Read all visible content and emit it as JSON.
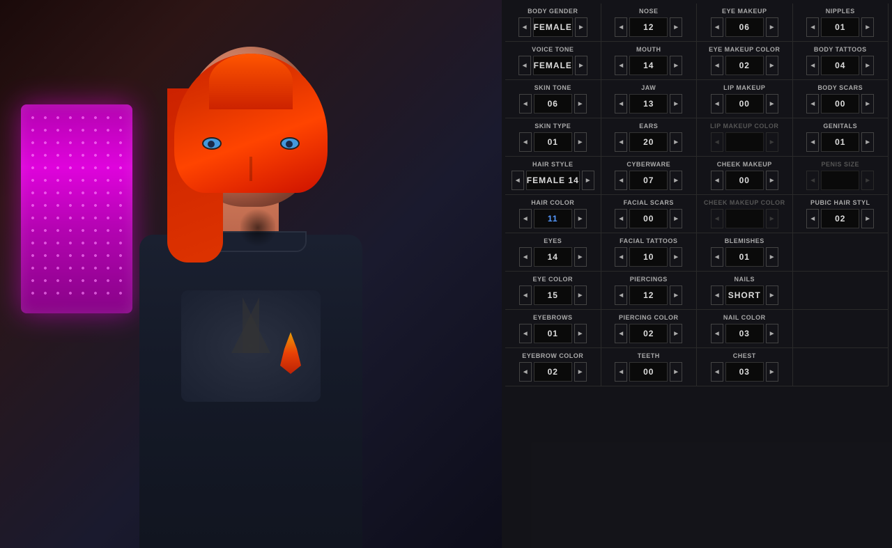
{
  "character_panel": {
    "rows": [
      {
        "cells": [
          {
            "label": "BODY GENDER",
            "value": "FEMALE",
            "value_class": "",
            "left_disabled": false,
            "right_disabled": false,
            "col": 1
          },
          {
            "label": "NOSE",
            "value": "12",
            "value_class": "",
            "left_disabled": false,
            "right_disabled": false,
            "col": 2
          },
          {
            "label": "EYE MAKEUP",
            "value": "06",
            "value_class": "",
            "left_disabled": false,
            "right_disabled": false,
            "col": 3
          },
          {
            "label": "NIPPLES",
            "value": "01",
            "value_class": "",
            "left_disabled": false,
            "right_disabled": false,
            "col": 4
          }
        ]
      },
      {
        "cells": [
          {
            "label": "VOICE TONE",
            "value": "FEMALE",
            "value_class": "",
            "left_disabled": false,
            "right_disabled": false,
            "col": 1
          },
          {
            "label": "MOUTH",
            "value": "14",
            "value_class": "",
            "left_disabled": false,
            "right_disabled": false,
            "col": 2
          },
          {
            "label": "EYE MAKEUP COLOR",
            "value": "02",
            "value_class": "",
            "left_disabled": false,
            "right_disabled": false,
            "col": 3
          },
          {
            "label": "BODY TATTOOS",
            "value": "04",
            "value_class": "",
            "left_disabled": false,
            "right_disabled": false,
            "col": 4
          }
        ]
      },
      {
        "cells": [
          {
            "label": "SKIN TONE",
            "value": "06",
            "value_class": "",
            "left_disabled": false,
            "right_disabled": false,
            "col": 1
          },
          {
            "label": "JAW",
            "value": "13",
            "value_class": "",
            "left_disabled": false,
            "right_disabled": false,
            "col": 2
          },
          {
            "label": "LIP MAKEUP",
            "value": "00",
            "value_class": "",
            "left_disabled": false,
            "right_disabled": false,
            "col": 3
          },
          {
            "label": "BODY SCARS",
            "value": "00",
            "value_class": "",
            "left_disabled": false,
            "right_disabled": false,
            "col": 4
          }
        ]
      },
      {
        "cells": [
          {
            "label": "SKIN TYPE",
            "value": "01",
            "value_class": "",
            "left_disabled": false,
            "right_disabled": false,
            "col": 1
          },
          {
            "label": "EARS",
            "value": "20",
            "value_class": "",
            "left_disabled": false,
            "right_disabled": false,
            "col": 2
          },
          {
            "label": "LIP MAKEUP COLOR",
            "value": "",
            "value_class": "disabled",
            "left_disabled": true,
            "right_disabled": true,
            "col": 3
          },
          {
            "label": "GENITALS",
            "value": "01",
            "value_class": "",
            "left_disabled": false,
            "right_disabled": false,
            "col": 4
          }
        ]
      },
      {
        "cells": [
          {
            "label": "HAIR STYLE",
            "value": "FEMALE 14",
            "value_class": "",
            "left_disabled": false,
            "right_disabled": false,
            "col": 1
          },
          {
            "label": "CYBERWARE",
            "value": "07",
            "value_class": "",
            "left_disabled": false,
            "right_disabled": false,
            "col": 2
          },
          {
            "label": "CHEEK MAKEUP",
            "value": "00",
            "value_class": "",
            "left_disabled": false,
            "right_disabled": false,
            "col": 3
          },
          {
            "label": "PENIS SIZE",
            "value": "",
            "value_class": "disabled",
            "left_disabled": true,
            "right_disabled": true,
            "col": 4
          }
        ]
      },
      {
        "cells": [
          {
            "label": "HAIR COLOR",
            "value": "11",
            "value_class": "blue",
            "left_disabled": false,
            "right_disabled": false,
            "col": 1
          },
          {
            "label": "FACIAL SCARS",
            "value": "00",
            "value_class": "",
            "left_disabled": false,
            "right_disabled": false,
            "col": 2
          },
          {
            "label": "CHEEK MAKEUP COLOR",
            "value": "",
            "value_class": "disabled",
            "left_disabled": true,
            "right_disabled": true,
            "col": 3
          },
          {
            "label": "PUBIC HAIR STYL",
            "value": "02",
            "value_class": "",
            "left_disabled": false,
            "right_disabled": false,
            "col": 4
          }
        ]
      },
      {
        "cells": [
          {
            "label": "EYES",
            "value": "14",
            "value_class": "",
            "left_disabled": false,
            "right_disabled": false,
            "col": 1
          },
          {
            "label": "FACIAL TATTOOS",
            "value": "10",
            "value_class": "",
            "left_disabled": false,
            "right_disabled": false,
            "col": 2
          },
          {
            "label": "BLEMISHES",
            "value": "01",
            "value_class": "",
            "left_disabled": false,
            "right_disabled": false,
            "col": 3
          },
          {
            "label": "",
            "value": "",
            "value_class": "",
            "left_disabled": true,
            "right_disabled": true,
            "col": 4,
            "empty": true
          }
        ]
      },
      {
        "cells": [
          {
            "label": "EYE COLOR",
            "value": "15",
            "value_class": "",
            "left_disabled": false,
            "right_disabled": false,
            "col": 1
          },
          {
            "label": "PIERCINGS",
            "value": "12",
            "value_class": "",
            "left_disabled": false,
            "right_disabled": false,
            "col": 2
          },
          {
            "label": "NAILS",
            "value": "SHORT",
            "value_class": "",
            "left_disabled": false,
            "right_disabled": false,
            "col": 3
          },
          {
            "label": "",
            "value": "",
            "value_class": "",
            "left_disabled": true,
            "right_disabled": true,
            "col": 4,
            "empty": true
          }
        ]
      },
      {
        "cells": [
          {
            "label": "EYEBROWS",
            "value": "01",
            "value_class": "",
            "left_disabled": false,
            "right_disabled": false,
            "col": 1
          },
          {
            "label": "PIERCING COLOR",
            "value": "02",
            "value_class": "",
            "left_disabled": false,
            "right_disabled": false,
            "col": 2
          },
          {
            "label": "NAIL COLOR",
            "value": "03",
            "value_class": "",
            "left_disabled": false,
            "right_disabled": false,
            "col": 3
          },
          {
            "label": "",
            "value": "",
            "value_class": "",
            "left_disabled": true,
            "right_disabled": true,
            "col": 4,
            "empty": true
          }
        ]
      },
      {
        "cells": [
          {
            "label": "EYEBROW COLOR",
            "value": "02",
            "value_class": "",
            "left_disabled": false,
            "right_disabled": false,
            "col": 1
          },
          {
            "label": "TEETH",
            "value": "00",
            "value_class": "",
            "left_disabled": false,
            "right_disabled": false,
            "col": 2
          },
          {
            "label": "CHEST",
            "value": "03",
            "value_class": "",
            "left_disabled": false,
            "right_disabled": false,
            "col": 3
          },
          {
            "label": "",
            "value": "",
            "value_class": "",
            "left_disabled": true,
            "right_disabled": true,
            "col": 4,
            "empty": true
          }
        ]
      }
    ],
    "btn_left": "◄",
    "btn_right": "►"
  }
}
